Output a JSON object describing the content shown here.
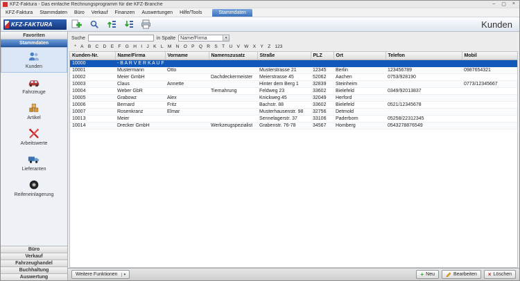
{
  "colors": {
    "selection": "#1258b8",
    "accent_blue": "#3a72bd",
    "accent_light": "#7aa7dd",
    "logo_red": "#d03030",
    "add_green": "#2e9e2e",
    "delete_red": "#c22222",
    "edit_yellow": "#e0a020"
  },
  "window": {
    "title": "KFZ-Faktura - Das einfache Rechnungsprogramm für die KFZ-Branche",
    "controls": {
      "minimize": "–",
      "maximize": "▢",
      "close": "×"
    }
  },
  "menu": {
    "items": [
      "KFZ-Faktura",
      "Stammdaten",
      "Büro",
      "Verkauf",
      "Finanzen",
      "Auswertungen",
      "Hilfe/Tools"
    ],
    "active_tab": "Stammdaten"
  },
  "toolbar": {
    "logo": "KFZ-FAKTURA",
    "page_title": "Kunden",
    "icons": [
      "new-record-icon",
      "search-icon",
      "sort-ascending-icon",
      "sort-descending-icon",
      "print-icon"
    ]
  },
  "search": {
    "label": "Suche",
    "value": "",
    "in_column_label": "in Spalte",
    "column_value": "Name/Firma"
  },
  "alphabet": [
    "*",
    "A",
    "B",
    "C",
    "D",
    "E",
    "F",
    "G",
    "H",
    "I",
    "J",
    "K",
    "L",
    "M",
    "N",
    "O",
    "P",
    "Q",
    "R",
    "S",
    "T",
    "U",
    "V",
    "W",
    "X",
    "Y",
    "Z",
    "123"
  ],
  "sidebar": {
    "favorites_header": "Favoriten",
    "group_header": "Stammdaten",
    "items": [
      {
        "label": "Kunden",
        "icon": "customers-icon"
      },
      {
        "label": "Fahrzeuge",
        "icon": "vehicles-icon"
      },
      {
        "label": "Artikel",
        "icon": "articles-icon"
      },
      {
        "label": "Arbeitswerte",
        "icon": "labor-values-icon"
      },
      {
        "label": "Lieferanten",
        "icon": "suppliers-icon"
      },
      {
        "label": "Reifeneinlagerung",
        "icon": "tire-storage-icon"
      }
    ],
    "bottom_items": [
      "Büro",
      "Verkauf",
      "Fahrzeughandel",
      "Buchhaltung",
      "Auswertung"
    ]
  },
  "table": {
    "columns": [
      "Kunden-Nr.",
      "Name/Firma",
      "Vorname",
      "Namenszusatz",
      "Straße",
      "PLZ",
      "Ort",
      "Telefon",
      "Mobil"
    ],
    "selected_index": 0,
    "rows": [
      [
        "10000",
        "- B A R V E R K A U F -",
        "",
        "",
        "",
        "",
        "",
        "",
        ""
      ],
      [
        "10001",
        "Mustermann",
        "Otto",
        "",
        "Musterstrasse 21",
        "12345",
        "Berlin",
        "123456789",
        "0987654321"
      ],
      [
        "10002",
        "Meier GmbH",
        "",
        "Dachdeckermeister",
        "Meierstrasse 45",
        "52062",
        "Aachen",
        "0753/928190",
        ""
      ],
      [
        "10003",
        "Claus",
        "Annette",
        "",
        "Hinter dem Berg 1",
        "32839",
        "Steinheim",
        "",
        "0773/12345667"
      ],
      [
        "10004",
        "Weber GbR",
        "",
        "Tiernahrung",
        "Feldweg 23",
        "33602",
        "Bielefeld",
        "0349/92013837",
        ""
      ],
      [
        "10005",
        "Grabowz",
        "Alex",
        "",
        "Knickweg 45",
        "32049",
        "Herford",
        "",
        ""
      ],
      [
        "10006",
        "Bernard",
        "Fritz",
        "",
        "Bachstr. 88",
        "33602",
        "Bielefeld",
        "0521/12345678",
        ""
      ],
      [
        "10007",
        "Rosenkranz",
        "Elmar",
        "",
        "Musterhausenstr. 98",
        "32756",
        "Detmold",
        "",
        ""
      ],
      [
        "10013",
        "Meier",
        "",
        "",
        "Sennelagerstr. 37",
        "33106",
        "Paderborn",
        "05258/22312345",
        ""
      ],
      [
        "10014",
        "Drecker GmbH",
        "",
        "Werkzeugspezialist",
        "Grabenstr. 76-78",
        "34567",
        "Homberg",
        "0543278876549",
        ""
      ]
    ]
  },
  "footer": {
    "more_functions": "Weitere Funktionen",
    "new": "Neu",
    "edit": "Bearbeiten",
    "delete": "Löschen"
  }
}
